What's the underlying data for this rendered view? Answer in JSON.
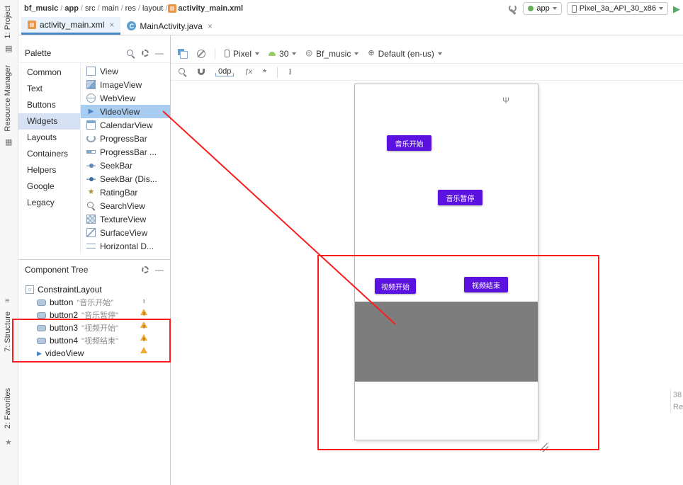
{
  "header": {
    "separator": "/",
    "breadcrumbs": [
      "bf_music",
      "app",
      "src",
      "main",
      "res",
      "layout",
      "activity_main.xml"
    ],
    "run_config": "app",
    "device": "Pixel_3a_API_30_x86"
  },
  "tabs": [
    {
      "label": "activity_main.xml"
    },
    {
      "label": "MainActivity.java"
    }
  ],
  "tool_windows": {
    "project": "1: Project",
    "resource_manager": "Resource Manager",
    "structure": "7: Structure",
    "favorites": "2: Favorites"
  },
  "palette": {
    "title": "Palette",
    "categories": [
      "Common",
      "Text",
      "Buttons",
      "Widgets",
      "Layouts",
      "Containers",
      "Helpers",
      "Google",
      "Legacy"
    ],
    "selected_category": "Widgets",
    "items": [
      "View",
      "ImageView",
      "WebView",
      "VideoView",
      "CalendarView",
      "ProgressBar",
      "ProgressBar ...",
      "SeekBar",
      "SeekBar (Dis...",
      "RatingBar",
      "SearchView",
      "TextureView",
      "SurfaceView",
      "Horizontal D..."
    ],
    "selected_item": "VideoView"
  },
  "component_tree": {
    "title": "Component Tree",
    "items": [
      {
        "name": "ConstraintLayout",
        "text": "",
        "warning": false
      },
      {
        "name": "button",
        "text": "\"音乐开始\"",
        "warning": true
      },
      {
        "name": "button2",
        "text": "\"音乐暂停\"",
        "warning": true
      },
      {
        "name": "button3",
        "text": "\"视频开始\"",
        "warning": true
      },
      {
        "name": "button4",
        "text": "\"视频结束\"",
        "warning": true
      },
      {
        "name": "videoView",
        "text": "",
        "warning": false
      }
    ]
  },
  "design_toolbar": {
    "device": "Pixel",
    "api": "30",
    "theme": "Bf_music",
    "locale": "Default (en-us)",
    "margin": "0dp"
  },
  "canvas": {
    "buttons": [
      {
        "label": "音乐开始"
      },
      {
        "label": "音乐暂停"
      },
      {
        "label": "视频开始"
      },
      {
        "label": "视频结束"
      }
    ]
  },
  "right_panel_fragment": {
    "line1": "38",
    "line2": "Re"
  },
  "colors": {
    "button_purple": "#5b11e0",
    "annotation_red": "#fb1d1d",
    "video_gray": "#7d7d7d",
    "warning_yellow": "#f0a832"
  },
  "icons": {
    "play": "▶",
    "run": "▶",
    "close": "×",
    "minus": "—",
    "star": "★",
    "menu": "≡",
    "project": "▤",
    "resource": "▦",
    "theme": "◎",
    "globe": "⊕",
    "antenna": "Ψ",
    "clear_constraints": "ƒx",
    "wand": "*",
    "cursor": "I",
    "class_letter": "C"
  }
}
